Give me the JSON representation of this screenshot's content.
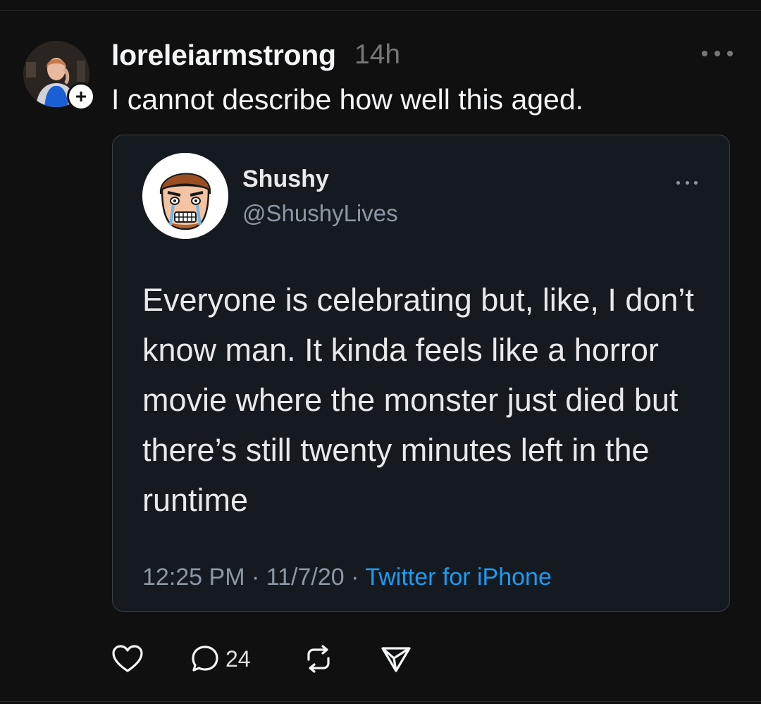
{
  "post": {
    "username": "loreleiarmstrong",
    "time": "14h",
    "text": "I cannot describe how well this aged.",
    "follow_symbol": "+"
  },
  "quoted_tweet": {
    "name": "Shushy",
    "handle": "@ShushyLives",
    "body": "Everyone is celebrating but, like, I don’t know man. It kinda feels like a horror movie where the monster just died but there’s still twenty minutes left in the runtime",
    "time": "12:25 PM",
    "date": "11/7/20",
    "separator": "·",
    "source": "Twitter for iPhone"
  },
  "actions": {
    "reply_count": "24"
  },
  "icons": {
    "like": "heart-icon",
    "reply": "speech-bubble-icon",
    "repost": "repost-icon",
    "share": "paper-plane-icon",
    "more": "more-icon"
  },
  "colors": {
    "background": "#101010",
    "card_background": "#151a21",
    "link": "#1d9bf0",
    "muted": "#777777"
  }
}
